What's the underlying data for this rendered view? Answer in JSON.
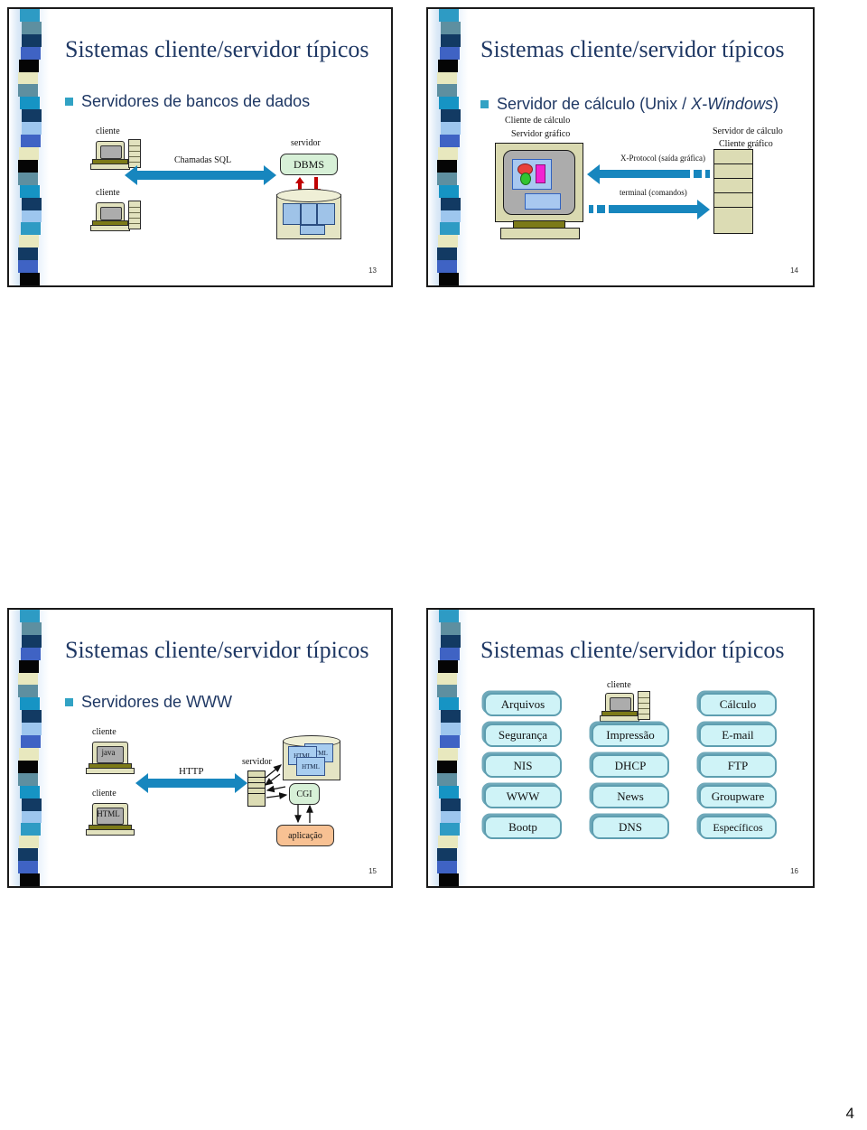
{
  "document": {
    "page_number": "4"
  },
  "palette": {
    "title_color": "#1F3864",
    "bullet_color": "#31A2C4",
    "arrow_blue": "#1786BE",
    "red_arrow": "#C00000",
    "green_box": "#D7F0D7",
    "orange_box": "#F8C193",
    "service_box": "#CFF3F7",
    "service_border": "#5E9EB0"
  },
  "strip_colors": [
    "#2E9BC4",
    "#5E8FA0",
    "#123A63",
    "#3F63C4",
    "#050505",
    "#E8E8BE",
    "#5E8FA0",
    "#1694C4",
    "#123A63",
    "#9DC6EE",
    "#3F63C4",
    "#E8E8BE",
    "#050505",
    "#5E8FA0",
    "#1694C4",
    "#123A63",
    "#9DC6EE",
    "#2E9BC4",
    "#E8E8BE",
    "#123A63",
    "#3F63C4",
    "#050505"
  ],
  "slides": [
    {
      "id": "slide-13",
      "number": "13",
      "title": "Sistemas cliente/servidor típicos",
      "bullet": "Servidores de bancos de dados",
      "labels": {
        "client_top": "cliente",
        "client_bottom": "cliente",
        "link": "Chamadas SQL",
        "server": "servidor",
        "dbms": "DBMS"
      }
    },
    {
      "id": "slide-14",
      "number": "14",
      "title": "Sistemas cliente/servidor típicos",
      "bullet_plain": "Servidor de cálculo (Unix / ",
      "bullet_italic": "X-Windows",
      "bullet_tail": ")",
      "labels": {
        "left_line1": "Cliente de cálculo",
        "left_line2": "Servidor gráfico",
        "right_line1": "Servidor de cálculo",
        "right_line2": "Cliente gráfico",
        "arrow_top_italic": "X-Protocol",
        "arrow_top_rest": " (saída gráfica)",
        "arrow_bottom_italic": "terminal",
        "arrow_bottom_rest": " (comandos)"
      }
    },
    {
      "id": "slide-15",
      "number": "15",
      "title": "Sistemas cliente/servidor típicos",
      "bullet": "Servidores de WWW",
      "labels": {
        "client_top": "cliente",
        "client_top_tech": "java",
        "client_bottom": "cliente",
        "client_bottom_tech": "HTML",
        "link": "HTTP",
        "server": "servidor",
        "page1": "HTML",
        "page2": "HTML",
        "page3": "HTML",
        "cgi": "CGI",
        "app": "aplicação"
      }
    },
    {
      "id": "slide-16",
      "number": "16",
      "title": "Sistemas cliente/servidor típicos",
      "client_label": "cliente",
      "services": [
        [
          "Arquivos",
          "",
          "Cálculo"
        ],
        [
          "Segurança",
          "Impressão",
          "E-mail"
        ],
        [
          "NIS",
          "DHCP",
          "FTP"
        ],
        [
          "WWW",
          "News",
          "Groupware"
        ],
        [
          "Bootp",
          "DNS",
          "Específicos"
        ]
      ]
    }
  ]
}
